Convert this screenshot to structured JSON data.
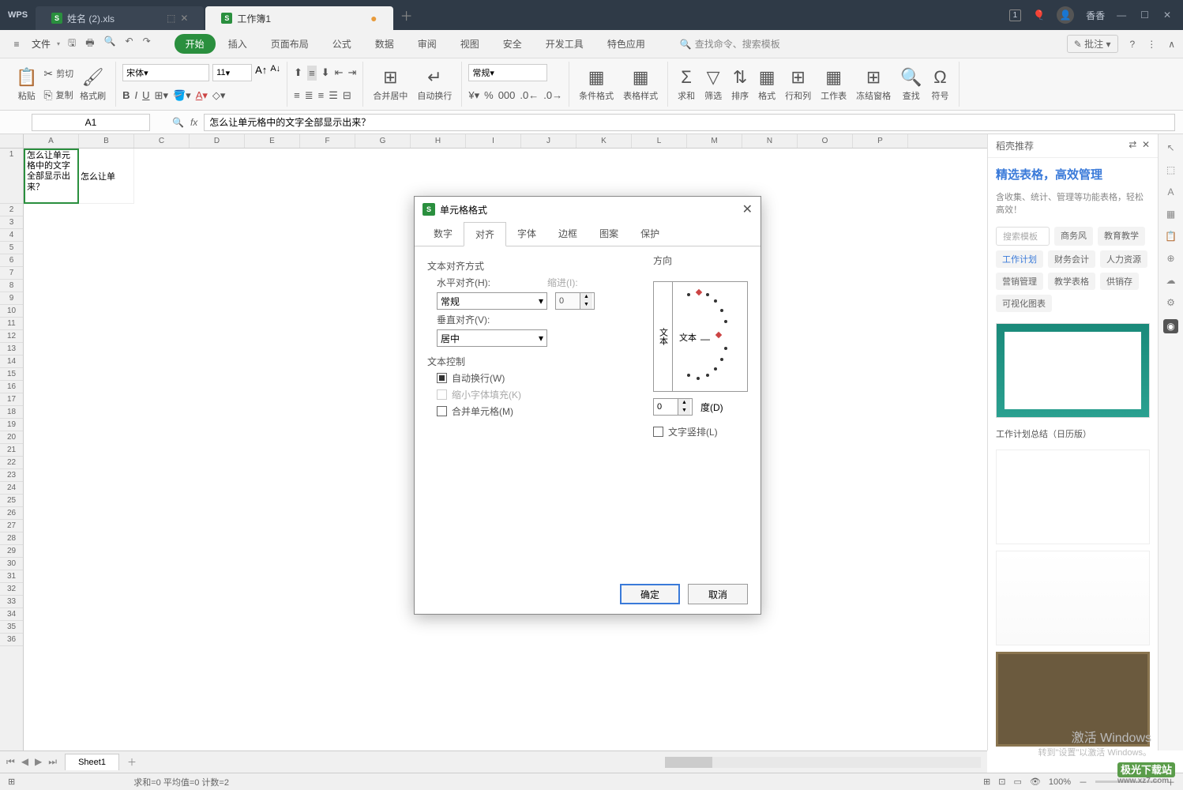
{
  "titlebar": {
    "logo": "WPS",
    "tabs": [
      {
        "icon": "S",
        "label": "姓名 (2).xls",
        "active": false
      },
      {
        "icon": "S",
        "label": "工作簿1",
        "active": true
      }
    ],
    "badge": "1",
    "user": "香香"
  },
  "menubar": {
    "file": "文件",
    "ribbon_tabs": [
      "开始",
      "插入",
      "页面布局",
      "公式",
      "数据",
      "审阅",
      "视图",
      "安全",
      "开发工具",
      "特色应用"
    ],
    "active_tab": 0,
    "search": "查找命令、搜索模板",
    "note": "批注"
  },
  "ribbon": {
    "paste": "粘贴",
    "cut": "剪切",
    "copy": "复制",
    "format_painter": "格式刷",
    "font_name": "宋体",
    "font_size": "11",
    "merge": "合并居中",
    "wrap": "自动换行",
    "number_fmt": "常规",
    "cond_fmt": "条件格式",
    "table_style": "表格样式",
    "sum": "求和",
    "filter": "筛选",
    "sort": "排序",
    "format": "格式",
    "rowcol": "行和列",
    "worksheet": "工作表",
    "freeze": "冻结窗格",
    "find": "查找",
    "symbol": "符号"
  },
  "formula_bar": {
    "name_box": "A1",
    "formula": "怎么让单元格中的文字全部显示出来？"
  },
  "sheet": {
    "columns": [
      "A",
      "B",
      "C",
      "D",
      "E",
      "F",
      "G",
      "H",
      "I",
      "J",
      "K",
      "L",
      "M",
      "N",
      "O",
      "P"
    ],
    "rows": 36,
    "a1": "怎么让单元格中的文字全部显示出来？",
    "b1": "怎么让单",
    "active_sheet": "Sheet1"
  },
  "dialog": {
    "title": "单元格格式",
    "tabs": [
      "数字",
      "对齐",
      "字体",
      "边框",
      "图案",
      "保护"
    ],
    "active_tab": 1,
    "align_group": "文本对齐方式",
    "h_align_label": "水平对齐(H):",
    "h_align_value": "常规",
    "indent_label": "缩进(I):",
    "indent_value": "0",
    "v_align_label": "垂直对齐(V):",
    "v_align_value": "居中",
    "text_control": "文本控制",
    "wrap": "自动换行(W)",
    "shrink": "缩小字体填充(K)",
    "merge": "合并单元格(M)",
    "direction": "方向",
    "dir_side": "文本",
    "dir_text": "文本",
    "degree_value": "0",
    "degree_label": "度(D)",
    "vertical_text": "文字竖排(L)",
    "ok": "确定",
    "cancel": "取消"
  },
  "right_panel": {
    "header": "稻壳推荐",
    "title": "精选表格，高效管理",
    "subtitle": "含收集、统计、管理等功能表格，轻松高效！",
    "tags": [
      "搜索模板",
      "商务风",
      "教育教学",
      "工作计划",
      "财务会计",
      "人力资源",
      "营销管理",
      "教学表格",
      "供销存",
      "可视化图表"
    ],
    "selected_tag": 3,
    "thumb2_title": "工作计划总结（日历版）"
  },
  "status": {
    "stats": "求和=0  平均值=0  计数=2",
    "zoom": "100%"
  },
  "watermark": {
    "line1": "激活 Windows",
    "line2": "转到\"设置\"以激活 Windows。",
    "brand": "极光下载站",
    "url": "www.xz7.com"
  }
}
